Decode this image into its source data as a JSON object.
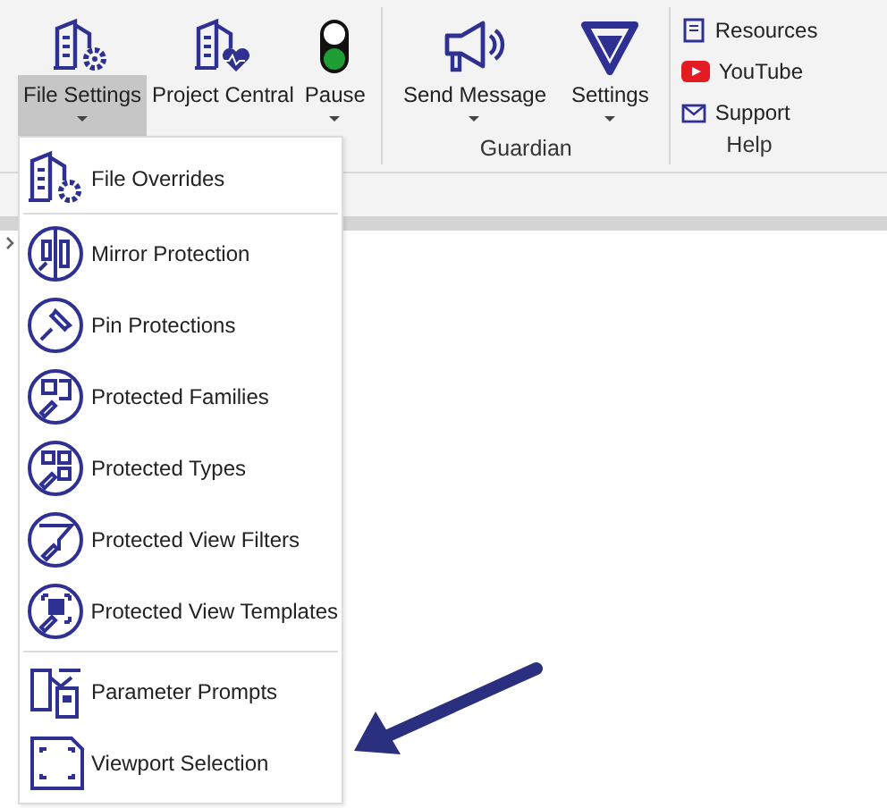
{
  "ribbon": {
    "groups": [
      {
        "buttons": [
          {
            "label": "File Settings",
            "selected": true,
            "dropdown": true
          },
          {
            "label": "Project Central",
            "selected": false,
            "dropdown": false
          },
          {
            "label": "Pause",
            "selected": false,
            "dropdown": true
          }
        ]
      },
      {
        "label": "Guardian",
        "buttons": [
          {
            "label": "Send Message",
            "selected": false,
            "dropdown": true
          },
          {
            "label": "Settings",
            "selected": false,
            "dropdown": true
          }
        ]
      },
      {
        "label": "Help",
        "links": [
          "Resources",
          "YouTube",
          "Support"
        ]
      }
    ]
  },
  "menu": {
    "sections": [
      [
        "File Overrides"
      ],
      [
        "Mirror Protection",
        "Pin Protections",
        "Protected Families",
        "Protected Types",
        "Protected View Filters",
        "Protected View Templates"
      ],
      [
        "Parameter Prompts",
        "Viewport Selection"
      ]
    ]
  }
}
